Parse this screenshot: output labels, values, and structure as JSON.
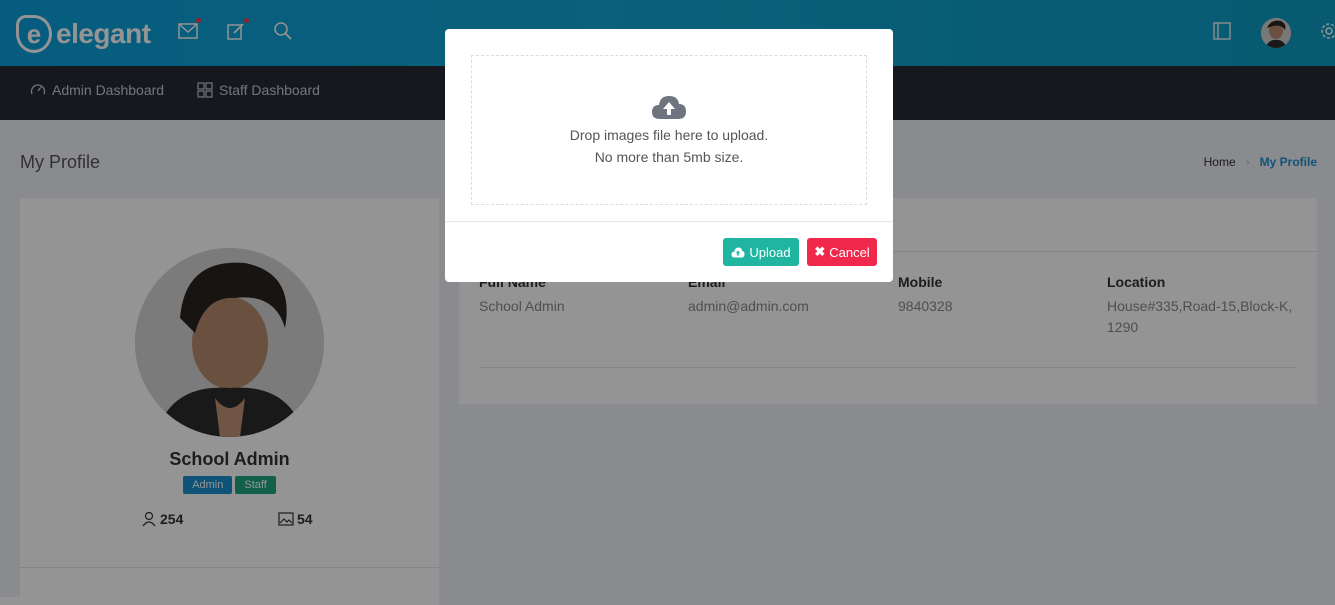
{
  "header": {
    "logo_letter": "e",
    "logo_text": "elegant"
  },
  "nav": {
    "items": [
      {
        "label": "Admin Dashboard",
        "icon": "dashboard-gauge-icon"
      },
      {
        "label": "Staff Dashboard",
        "icon": "grid-icon"
      }
    ]
  },
  "page": {
    "title": "My Profile",
    "breadcrumb": {
      "home": "Home",
      "current": "My Profile"
    }
  },
  "profile": {
    "name": "School Admin",
    "badges": [
      {
        "label": "Admin",
        "color": "#1a8fd1"
      },
      {
        "label": "Staff",
        "color": "#1fa67f"
      }
    ],
    "stats": [
      {
        "icon": "users-icon",
        "value": "254"
      },
      {
        "icon": "image-icon",
        "value": "54"
      }
    ]
  },
  "info": {
    "fields": [
      {
        "label": "Full Name",
        "value": "School Admin"
      },
      {
        "label": "Email",
        "value": "admin@admin.com"
      },
      {
        "label": "Mobile",
        "value": "9840328"
      },
      {
        "label": "Location",
        "value": "House#335,Road-15,Block-K, 1290"
      }
    ]
  },
  "modal": {
    "drop_line1": "Drop images file here to upload.",
    "drop_line2": "No more than 5mb size.",
    "upload_label": "Upload",
    "cancel_label": "Cancel",
    "upload_color": "#1fb5a0",
    "cancel_color": "#f0284b"
  }
}
